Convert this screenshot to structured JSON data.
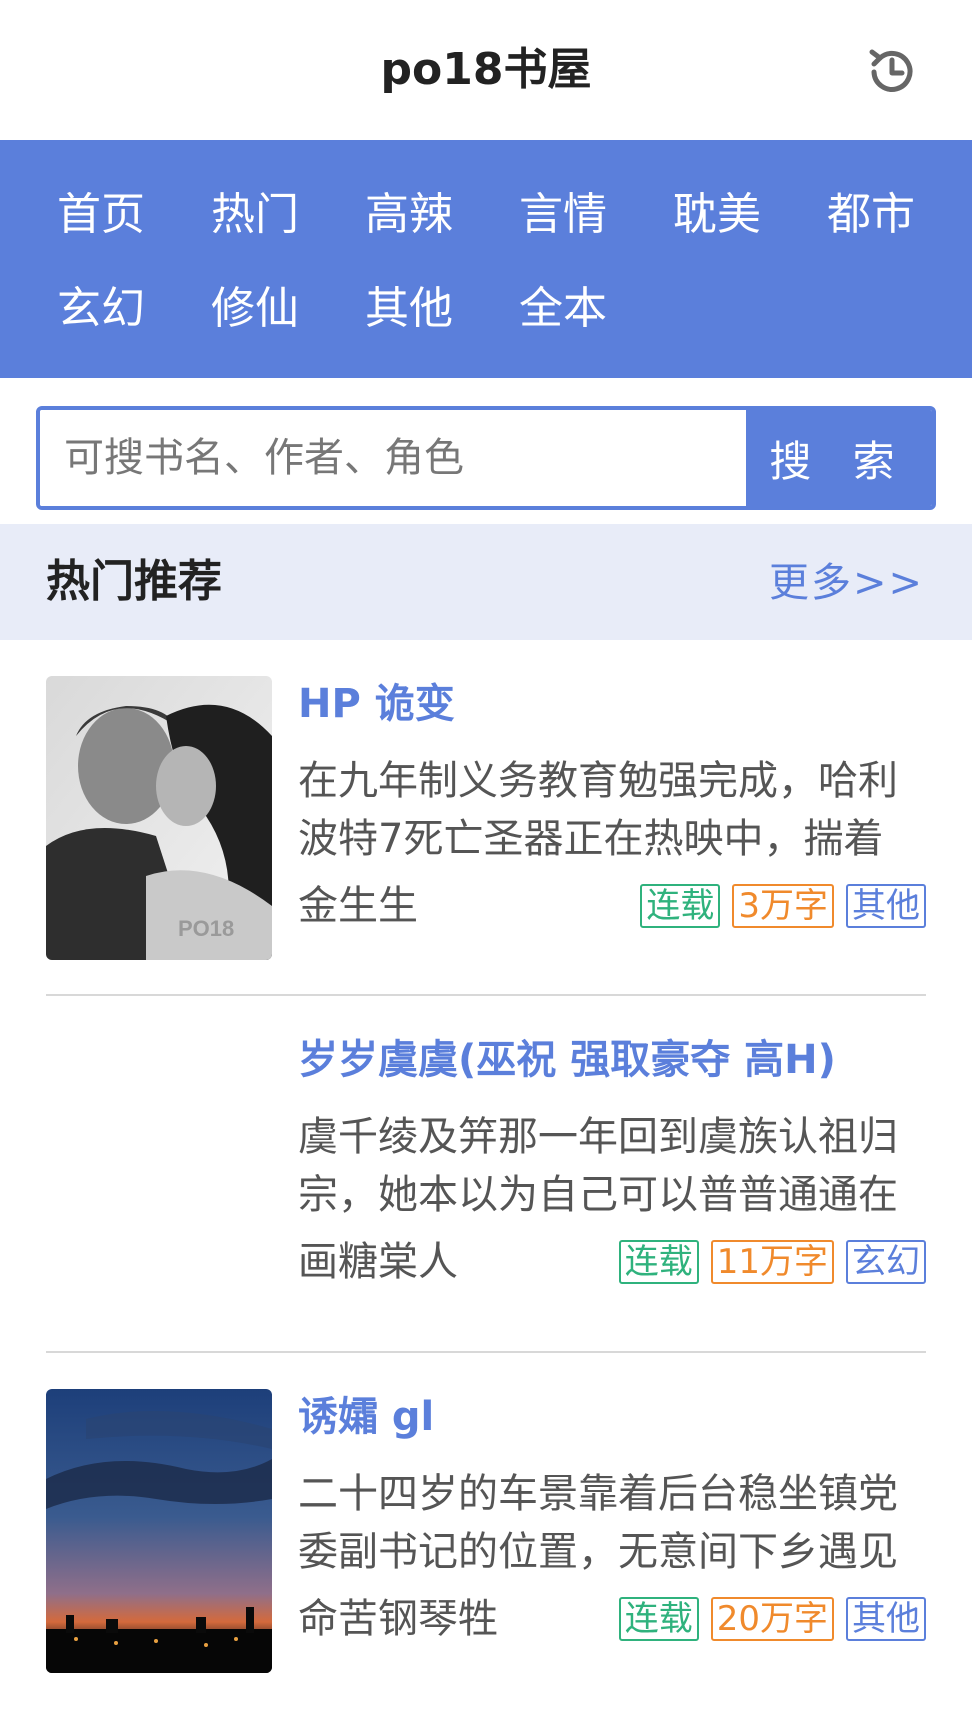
{
  "header": {
    "title": "po18书屋",
    "history_icon": "history-clock-icon"
  },
  "nav": {
    "row1": [
      "首页",
      "热门",
      "高辣",
      "言情",
      "耽美",
      "都市"
    ],
    "row2": [
      "玄幻",
      "修仙",
      "其他",
      "全本"
    ]
  },
  "search": {
    "placeholder": "可搜书名、作者、角色",
    "value": "",
    "button_label": "搜 索"
  },
  "section": {
    "title": "热门推荐",
    "more_label": "更多>>"
  },
  "books": [
    {
      "title": "HP 诡变",
      "desc": "在九年制义务教育勉强完成，哈利波特7死亡圣器正在热映中，揣着",
      "author": "金生生",
      "tags": [
        "连载",
        "3万字",
        "其他"
      ],
      "cover": "couple-photo-cover"
    },
    {
      "title": "岁岁虞虞(巫祝 强取豪夺 高H)",
      "desc": "虞千绫及笄那一年回到虞族认祖归宗，她本以为自己可以普普通通在",
      "author": "画糖棠人",
      "tags": [
        "连载",
        "11万字",
        "玄幻"
      ],
      "cover": "blank-cover"
    },
    {
      "title": "诱孀 gl",
      "desc": "二十四岁的车景靠着后台稳坐镇党委副书记的位置，无意间下乡遇见",
      "author": "命苦钢琴牲",
      "tags": [
        "连载",
        "20万字",
        "其他"
      ],
      "cover": "sunset-city-cover"
    }
  ],
  "colors": {
    "accent": "#5b7fdb",
    "tag_status": "#2fb27d",
    "tag_words": "#f08a2c",
    "tag_category": "#5b7fdb",
    "section_bg": "#e8ecf8"
  }
}
